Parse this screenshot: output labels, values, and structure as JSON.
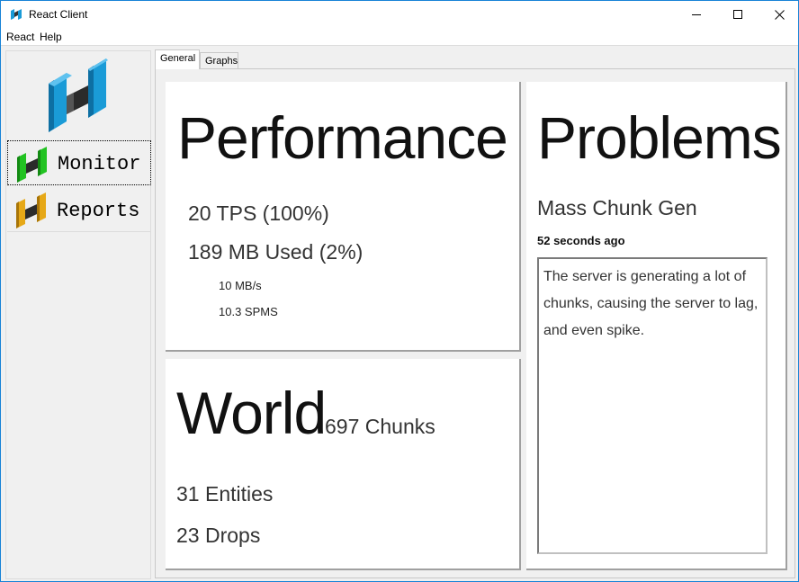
{
  "window": {
    "title": "React Client",
    "accent_color": "#1883d7"
  },
  "menu": {
    "items": [
      "React",
      "Help"
    ]
  },
  "sidebar": {
    "logo_icon": "react-logo-icon",
    "items": [
      {
        "label": "Monitor",
        "icon": "monitor-logo-icon",
        "color": "#22c322"
      },
      {
        "label": "Reports",
        "icon": "reports-logo-icon",
        "color": "#e6a817"
      }
    ]
  },
  "tabs": [
    {
      "label": "General",
      "selected": true
    },
    {
      "label": "Graphs",
      "selected": false
    }
  ],
  "performance": {
    "title": "Performance",
    "tps": "20 TPS (100%)",
    "memory": "189 MB Used (2%)",
    "rate": "10 MB/s",
    "spms": "10.3 SPMS"
  },
  "world": {
    "title": "World",
    "chunks": "697 Chunks",
    "entities": "31 Entities",
    "drops": "23 Drops"
  },
  "problems": {
    "title": "Problems",
    "name": "Mass Chunk Gen",
    "time": "52 seconds ago",
    "description": "The server is generating a lot of chunks, causing the server to lag, and even spike."
  }
}
